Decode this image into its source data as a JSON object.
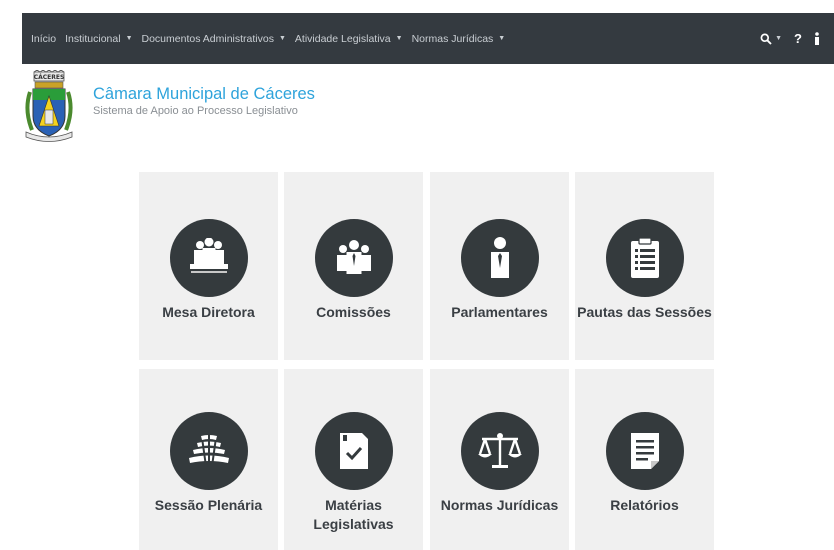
{
  "nav": {
    "items": [
      {
        "label": "Início",
        "dropdown": false
      },
      {
        "label": "Institucional",
        "dropdown": true
      },
      {
        "label": "Documentos Administrativos",
        "dropdown": true
      },
      {
        "label": "Atividade Legislativa",
        "dropdown": true
      },
      {
        "label": "Normas Jurídicas",
        "dropdown": true
      }
    ],
    "search_icon": "search-icon",
    "help_label": "?",
    "info_icon": "user-info-icon",
    "background": "#343a40"
  },
  "header": {
    "crest_text": "CÁCERES",
    "title": "Câmara Municipal de Cáceres",
    "subtitle": "Sistema de Apoio ao Processo Legislativo",
    "title_color": "#2ea3db"
  },
  "tiles": [
    {
      "label": "Mesa Diretora",
      "icon": "mesa-diretora-icon"
    },
    {
      "label": "Comissões",
      "icon": "comissoes-icon"
    },
    {
      "label": "Parlamentares",
      "icon": "parlamentares-icon"
    },
    {
      "label": "Pautas das Sessões",
      "icon": "pautas-icon"
    },
    {
      "label": "Sessão Plenária",
      "icon": "sessao-plenaria-icon"
    },
    {
      "label": "Matérias Legislativas",
      "icon": "materias-icon"
    },
    {
      "label": "Normas Jurídicas",
      "icon": "normas-icon"
    },
    {
      "label": "Relatórios",
      "icon": "relatorios-icon"
    }
  ]
}
